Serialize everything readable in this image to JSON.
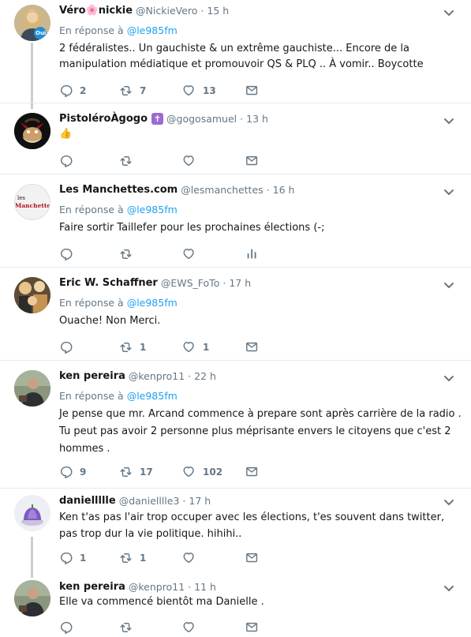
{
  "tweets": [
    {
      "name": "Véro🌸nickie",
      "handle": "@NickieVero",
      "time": "15 h",
      "reply_label": "En réponse à",
      "reply_mention": "@le985fm",
      "text": "2 fédéralistes.. Un gauchiste & un extrême gauchiste... Encore de la manipulation médiatique et promouvoir QS & PLQ .. À vomir.. Boycotte",
      "replies": "2",
      "retweets": "7",
      "likes": "13",
      "last_action": "mail-icon"
    },
    {
      "name": "PistoléroÀgogo",
      "badge": "✝",
      "handle": "@gogosamuel",
      "time": "13 h",
      "text": "👍",
      "replies": "",
      "retweets": "",
      "likes": "",
      "last_action": "mail-icon"
    },
    {
      "name": "Les Manchettes.com",
      "handle": "@lesmanchettes",
      "time": "16 h",
      "reply_label": "En réponse à",
      "reply_mention": "@le985fm",
      "text": "Faire sortir Taillefer pour les prochaines élections (-;",
      "avatar_text_top": "les",
      "avatar_text_bottom": "Manchettes",
      "replies": "",
      "retweets": "",
      "likes": "",
      "last_action": "analytics-icon"
    },
    {
      "name": "Eric W. Schaffner",
      "handle": "@EWS_FoTo",
      "time": "17 h",
      "reply_label": "En réponse à",
      "reply_mention": "@le985fm",
      "text": "Ouache! Non Merci.",
      "replies": "",
      "retweets": "1",
      "likes": "1",
      "last_action": "mail-icon"
    },
    {
      "name": "ken pereira",
      "handle": "@kenpro11",
      "time": "22 h",
      "reply_label": "En réponse à",
      "reply_mention": "@le985fm",
      "text": "Je pense que mr. Arcand commence à prepare sont après carrière de la radio . Tu peut pas avoir 2 personne plus méprisante envers le citoyens que c'est 2 hommes .",
      "replies": "9",
      "retweets": "17",
      "likes": "102",
      "last_action": "mail-icon"
    },
    {
      "name": "daniellllle",
      "handle": "@danielllle3",
      "time": "17 h",
      "text": "Ken t'as pas l'air trop occuper avec les élections, t'es souvent dans twitter, pas trop dur la vie politique. hihihi..",
      "replies": "1",
      "retweets": "1",
      "likes": "",
      "last_action": "mail-icon"
    },
    {
      "name": "ken pereira",
      "handle": "@kenpro11",
      "time": "11 h",
      "text": "Elle va commencé bientôt ma Danielle .",
      "replies": "",
      "retweets": "",
      "likes": "",
      "last_action": "mail-icon"
    }
  ],
  "avatar_badge_text": "Oui",
  "colors": {
    "link": "#1da1f2",
    "muted": "#657786",
    "divider": "#e6ecf0",
    "thread": "#c4cfd6",
    "text": "#14171a"
  }
}
